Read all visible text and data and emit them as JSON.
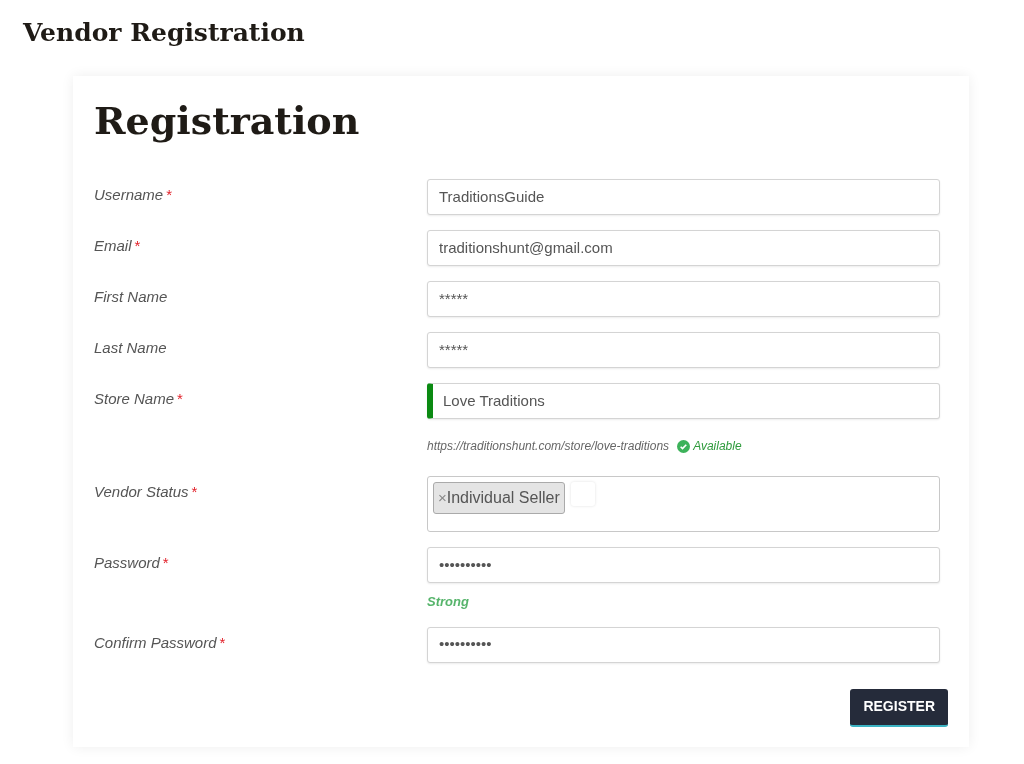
{
  "page_title": "Vendor Registration",
  "form": {
    "title": "Registration",
    "fields": [
      {
        "kind": "text",
        "label": "Username",
        "marker": "*",
        "value": "TraditionsGuide"
      },
      {
        "kind": "text",
        "label": "Email",
        "marker": "*",
        "value": "traditionshunt@gmail.com"
      },
      {
        "kind": "text",
        "label": "First Name",
        "value": "*****"
      },
      {
        "kind": "text",
        "label": "Last Name",
        "value": "*****"
      },
      {
        "kind": "text",
        "label": "Store Name",
        "marker": "*",
        "value": "Love Traditions",
        "valid": true,
        "url_hint": "https://traditionshunt.com/store/love-traditions",
        "availability": "Available"
      },
      {
        "kind": "tags",
        "label": "Vendor Status",
        "marker": "*",
        "tags": [
          {
            "remove": "×",
            "label": "Individual Seller"
          }
        ]
      },
      {
        "kind": "text",
        "label": "Password",
        "marker": "*",
        "value": "••••••••••",
        "strength": "Strong"
      },
      {
        "kind": "text",
        "label": "Confirm Password",
        "marker": "*",
        "value": "••••••••••"
      }
    ],
    "submit": "REGISTER"
  }
}
